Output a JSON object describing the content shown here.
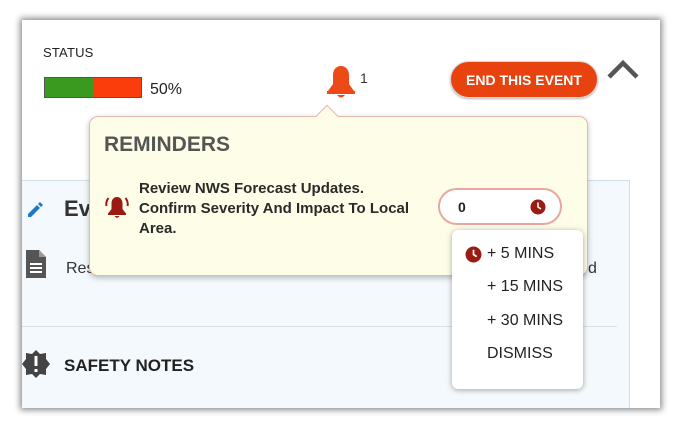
{
  "status": {
    "label": "STATUS",
    "progress_percent": 50,
    "progress_text": "50%",
    "colors": {
      "complete": "#3a9a1f",
      "remaining": "#fb3d0b"
    }
  },
  "notifications": {
    "icon": "bell-icon",
    "count": "1",
    "color": "#e8420e"
  },
  "header": {
    "end_event_label": "END THIS EVENT",
    "collapse_icon": "chevron-up-icon"
  },
  "event_panel": {
    "heading": "Ev",
    "description_start": "Res",
    "description_end": "d",
    "safety_heading": "SAFETY NOTES"
  },
  "reminders": {
    "title": "REMINDERS",
    "item_text": "Review NWS Forecast Updates. Confirm Severity And Impact To Local Area.",
    "snooze_value": "0",
    "alarm_color": "#9b1a12",
    "menu": {
      "options": [
        "+ 5 MINS",
        "+ 15 MINS",
        "+ 30 MINS"
      ],
      "dismiss": "DISMISS"
    }
  }
}
